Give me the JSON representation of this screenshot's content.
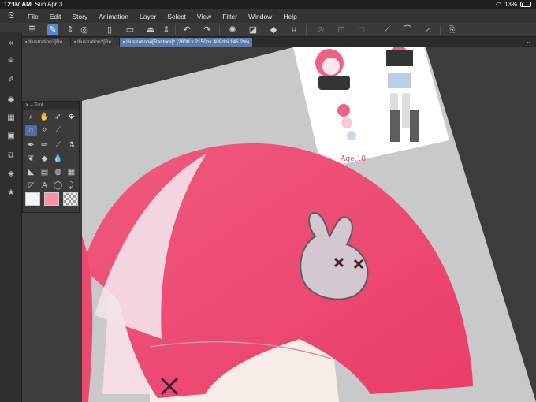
{
  "status": {
    "time": "12:07 AM",
    "date": "Sun Apr 3",
    "battery": "13%"
  },
  "menu": [
    "File",
    "Edit",
    "Story",
    "Animation",
    "Layer",
    "Select",
    "View",
    "Filter",
    "Window",
    "Help"
  ],
  "tabs": [
    "Illustration3[Re...",
    "Illustration2[Re...",
    "Illustration4[Restore]* (2800 x 2150px 400dpi 146.2%)"
  ],
  "tool_palette": {
    "title": "Tool"
  },
  "artwork": {
    "caption": "Age:18"
  },
  "colors": {
    "hair": "#ef4b72",
    "main_color": "#f7f3f6",
    "sub_color": "#ff8fa8",
    "accent": "#5b87c7"
  }
}
